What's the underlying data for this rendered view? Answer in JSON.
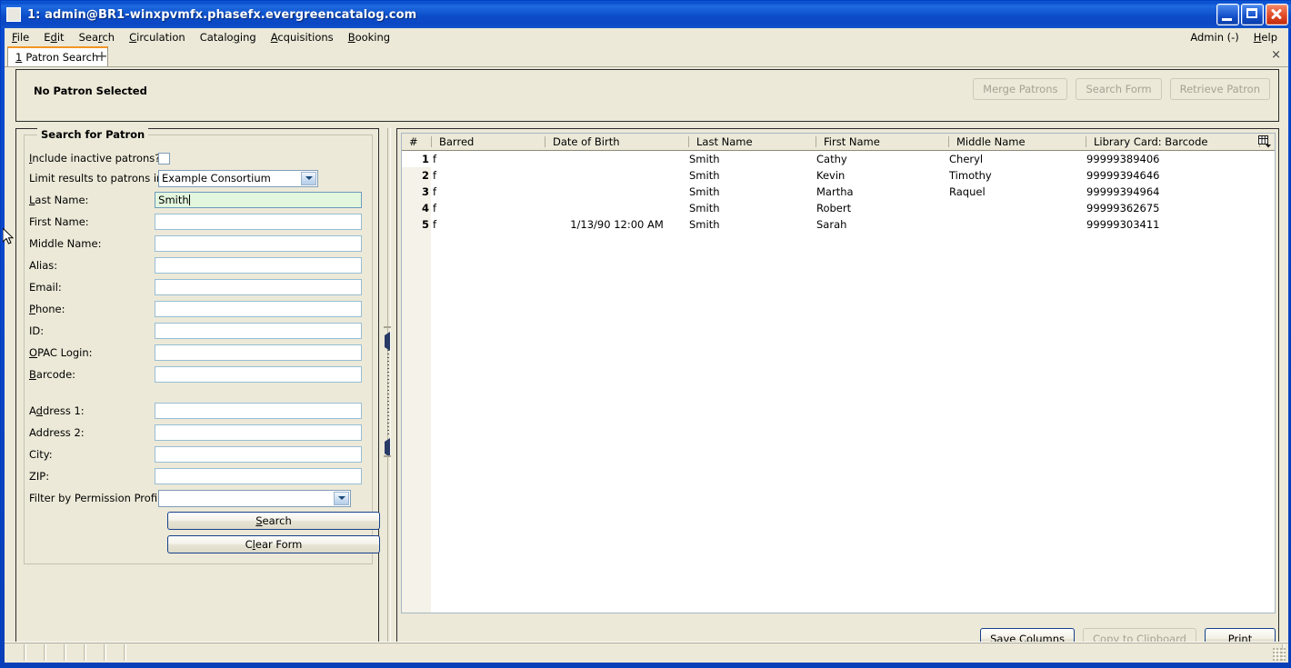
{
  "window": {
    "title": "1: admin@BR1-winxpvmfx.phasefx.evergreencatalog.com",
    "icon": "app-icon",
    "minimize": "minimize-icon",
    "maximize": "maximize-icon",
    "close": "close-icon",
    "titlebar_color": "#0a4bd1"
  },
  "menubar": {
    "items": [
      {
        "label": "File",
        "accel": "F"
      },
      {
        "label": "Edit",
        "accel": "E"
      },
      {
        "label": "Search",
        "accel": "r"
      },
      {
        "label": "Circulation",
        "accel": "C"
      },
      {
        "label": "Cataloging",
        "accel": "g"
      },
      {
        "label": "Acquisitions",
        "accel": "A"
      },
      {
        "label": "Booking",
        "accel": "B"
      }
    ],
    "right": [
      {
        "label": "Admin (-)"
      },
      {
        "label": "Help"
      }
    ]
  },
  "tabs": {
    "active": {
      "number": "1",
      "label": "Patron Search"
    },
    "new_tab_icon": "plus-icon",
    "close_icon": "×"
  },
  "patron_header": {
    "status": "No Patron Selected",
    "buttons": [
      {
        "label": "Merge Patrons",
        "enabled": false
      },
      {
        "label": "Search Form",
        "enabled": false
      },
      {
        "label": "Retrieve Patron",
        "enabled": false
      }
    ]
  },
  "search_form": {
    "title": "Search for Patron",
    "fields": [
      {
        "label": "Include inactive patrons?",
        "type": "checkbox",
        "value": "",
        "checked": false
      },
      {
        "label": "Limit results to patrons in",
        "type": "select",
        "value": "Example Consortium"
      },
      {
        "label": "Last Name:",
        "type": "text",
        "value": "Smith",
        "focused": true
      },
      {
        "label": "First Name:",
        "type": "text",
        "value": ""
      },
      {
        "label": "Middle Name:",
        "type": "text",
        "value": ""
      },
      {
        "label": "Alias:",
        "type": "text",
        "value": ""
      },
      {
        "label": "Email:",
        "type": "text",
        "value": ""
      },
      {
        "label": "Phone:",
        "type": "text",
        "value": ""
      },
      {
        "label": "ID:",
        "type": "text",
        "value": ""
      },
      {
        "label": "OPAC Login:",
        "type": "text",
        "value": ""
      },
      {
        "label": "Barcode:",
        "type": "text",
        "value": ""
      },
      {
        "label": "Address 1:",
        "type": "text",
        "value": ""
      },
      {
        "label": "Address 2:",
        "type": "text",
        "value": ""
      },
      {
        "label": "City:",
        "type": "text",
        "value": ""
      },
      {
        "label": "ZIP:",
        "type": "text",
        "value": ""
      },
      {
        "label": "Filter by Permission Profile:",
        "type": "select",
        "value": ""
      }
    ],
    "buttons": [
      {
        "label": "Search"
      },
      {
        "label": "Clear Form"
      }
    ]
  },
  "results": {
    "columns": [
      "#",
      "Barred",
      "Date of Birth",
      "Last Name",
      "First Name",
      "Middle Name",
      "Library Card: Barcode"
    ],
    "column_picker_icon": "column-picker-icon",
    "rows": [
      {
        "num": "1",
        "barred": "f",
        "dob": "",
        "last": "Smith",
        "first": "Cathy",
        "middle": "Cheryl",
        "barcode": "99999389406"
      },
      {
        "num": "2",
        "barred": "f",
        "dob": "",
        "last": "Smith",
        "first": "Kevin",
        "middle": "Timothy",
        "barcode": "99999394646"
      },
      {
        "num": "3",
        "barred": "f",
        "dob": "",
        "last": "Smith",
        "first": "Martha",
        "middle": "Raquel",
        "barcode": "99999394964"
      },
      {
        "num": "4",
        "barred": "f",
        "dob": "",
        "last": "Smith",
        "first": "Robert",
        "middle": "",
        "barcode": "99999362675"
      },
      {
        "num": "5",
        "barred": "f",
        "dob": "1/13/90 12:00 AM",
        "last": "Smith",
        "first": "Sarah",
        "middle": "",
        "barcode": "99999303411"
      }
    ],
    "footer_buttons": [
      {
        "label": "Save Columns",
        "enabled": true
      },
      {
        "label": "Copy to Clipboard",
        "enabled": false
      },
      {
        "label": "Print",
        "enabled": true
      }
    ]
  },
  "statusbar": {
    "cells": [
      "",
      "",
      "",
      "",
      "",
      "",
      ""
    ]
  }
}
